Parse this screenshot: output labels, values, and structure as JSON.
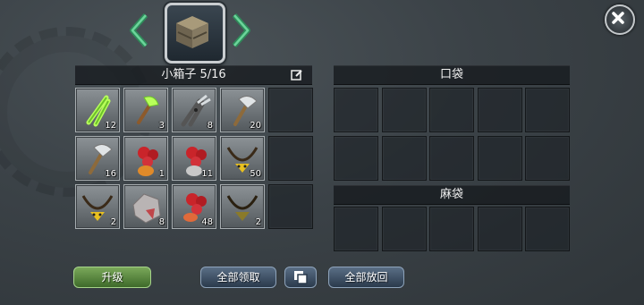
{
  "nav": {
    "prev_icon": "chevron-left-icon",
    "next_icon": "chevron-right-icon",
    "container_icon": "wooden-crate-icon",
    "close_icon": "close-icon"
  },
  "storage": {
    "title": "小箱子 5/16",
    "edit_icon": "edit-icon",
    "slots": [
      {
        "item": "green-scissors",
        "qty": "12"
      },
      {
        "item": "green-axe",
        "qty": "3"
      },
      {
        "item": "shears",
        "qty": "8"
      },
      {
        "item": "axe",
        "qty": "20"
      },
      {
        "item": "",
        "qty": ""
      },
      {
        "item": "axe",
        "qty": "16"
      },
      {
        "item": "red-berries",
        "qty": "1"
      },
      {
        "item": "red-berries-stone",
        "qty": "11"
      },
      {
        "item": "tribal-necklace",
        "qty": "50"
      },
      {
        "item": "",
        "qty": ""
      },
      {
        "item": "tribal-necklace",
        "qty": "2"
      },
      {
        "item": "stone-chunk",
        "qty": "8"
      },
      {
        "item": "red-berries-orange",
        "qty": "48"
      },
      {
        "item": "tribal-necklace-dark",
        "qty": "2"
      },
      {
        "item": "",
        "qty": ""
      }
    ]
  },
  "pocket": {
    "title": "口袋",
    "slot_count": 10
  },
  "sack": {
    "title": "麻袋",
    "slot_count": 5
  },
  "buttons": {
    "upgrade": "升级",
    "take_all": "全部领取",
    "sort_icon": "stack-icon",
    "return_all": "全部放回"
  },
  "colors": {
    "green_button": "#5a8a40",
    "blue_button": "#3f5266",
    "slot_filled": "#777d81"
  }
}
